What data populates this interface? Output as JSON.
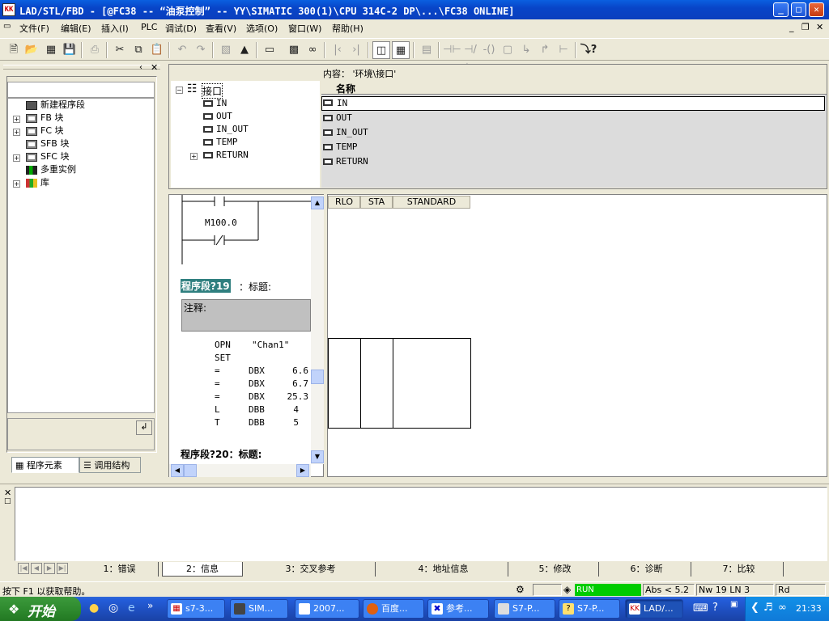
{
  "window": {
    "title": "LAD/STL/FBD  - [@FC38 -- “油泵控制” -- YY\\SIMATIC 300(1)\\CPU 314C-2 DP\\...\\FC38  ONLINE]",
    "min": "_",
    "max": "□",
    "close": "✕"
  },
  "menu": {
    "items": [
      "文件(F)",
      "编辑(E)",
      "插入(I)",
      "PLC",
      "调试(D)",
      "查看(V)",
      "选项(O)",
      "窗口(W)",
      "帮助(H)"
    ],
    "mdi_min": "_",
    "mdi_restore": "❐",
    "mdi_close": "✕"
  },
  "toolbar": {
    "icons": [
      "new-icon",
      "open-icon",
      "accessible-nodes-icon",
      "save-icon",
      "print-icon",
      "cut-icon",
      "copy-icon",
      "paste-icon",
      "undo-icon",
      "redo-icon",
      "download-icon",
      "load-icon",
      "monitor-icon",
      "breakpoint-icon",
      "glasses-icon",
      "first-icon",
      "last-icon",
      "overview-icon",
      "details-icon",
      "network-icon",
      "contact-no-icon",
      "contact-nc-icon",
      "coil-icon",
      "box-icon",
      "branch-open-icon",
      "branch-close-icon",
      "connection-icon",
      "help-icon"
    ]
  },
  "left_panel": {
    "tree": [
      {
        "label": "新建程序段",
        "icon": "new-network-icon",
        "expandable": false
      },
      {
        "label": "FB 块",
        "icon": "fb-block-icon",
        "expandable": true
      },
      {
        "label": "FC 块",
        "icon": "fc-block-icon",
        "expandable": true
      },
      {
        "label": "SFB 块",
        "icon": "sfb-block-icon",
        "expandable": false
      },
      {
        "label": "SFC 块",
        "icon": "sfc-block-icon",
        "expandable": true
      },
      {
        "label": "多重实例",
        "icon": "multi-instance-icon",
        "expandable": false
      },
      {
        "label": "库",
        "icon": "library-icon",
        "expandable": true
      }
    ],
    "tabs": [
      "程序元素",
      "调用结构"
    ]
  },
  "interface": {
    "content_label": "内容： '环境\\接口'",
    "tree_root": "接口",
    "tree_items": [
      "IN",
      "OUT",
      "IN_OUT",
      "TEMP",
      "RETURN"
    ],
    "column_header": "名称",
    "list_items": [
      "IN",
      "OUT",
      "IN_OUT",
      "TEMP",
      "RETURN"
    ]
  },
  "editor": {
    "contact_label": "M100.0",
    "network19_title": "程序段?19",
    "network19_suffix": "：标题:",
    "comment_label": "注释:",
    "code": [
      {
        "op": "OPN",
        "a": "\"Chan1\"",
        "b": ""
      },
      {
        "op": "SET",
        "a": "",
        "b": ""
      },
      {
        "op": "=",
        "a": "DBX",
        "b": "6.6"
      },
      {
        "op": "=",
        "a": "DBX",
        "b": "6.7"
      },
      {
        "op": "=",
        "a": "DBX",
        "b": "25.3"
      },
      {
        "op": "L",
        "a": "DBB",
        "b": "4"
      },
      {
        "op": "T",
        "a": "DBB",
        "b": "5"
      }
    ],
    "network20": "程序段?20：标题:"
  },
  "status_grid": {
    "headers": [
      "RLO",
      "STA",
      "STANDARD"
    ]
  },
  "bottom_tabs": [
    "1：错误",
    "2：信息",
    "3：交叉参考",
    "4：地址信息",
    "5：修改",
    "6：诊断",
    "7：比较"
  ],
  "statusbar": {
    "help": "按下 F1 以获取帮助。",
    "run": "RUN",
    "abs": "Abs < 5.2",
    "pos": "Nw 19  LN 3",
    "mode": "Rd"
  },
  "taskbar": {
    "start": "开始",
    "tasks": [
      "s7-3...",
      "SIM...",
      "2007...",
      "百度...",
      "参考...",
      "S7-P...",
      "S7-P...",
      "LAD/..."
    ],
    "clock": "21:33"
  },
  "colors": {
    "run_green": "#00cc00",
    "title_blue": "#0a5fe0",
    "highlight": "#2f7f7f"
  }
}
